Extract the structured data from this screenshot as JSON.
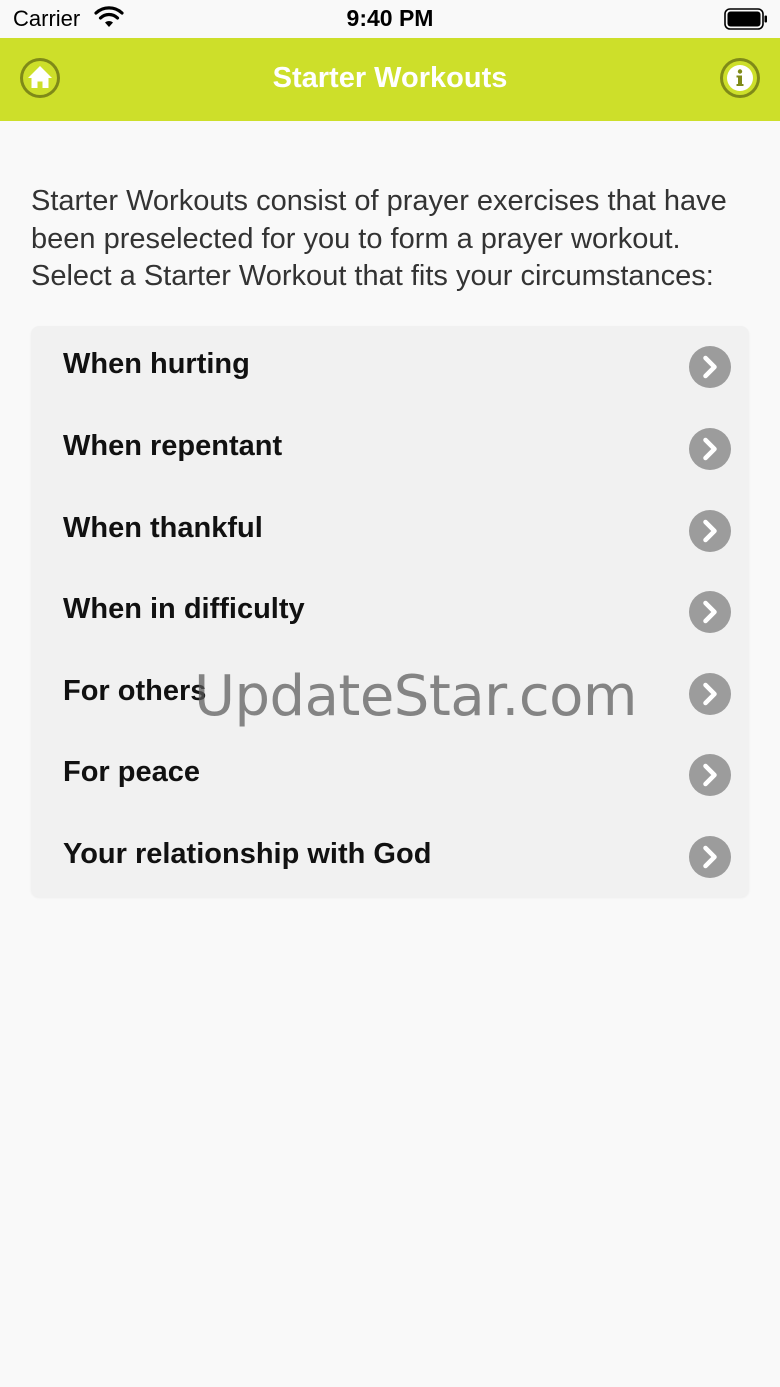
{
  "status_bar": {
    "carrier": "Carrier",
    "time": "9:40 PM"
  },
  "nav": {
    "title": "Starter Workouts",
    "bar_color": "#cddf2a",
    "left_icon": "home-icon",
    "right_icon": "info-icon"
  },
  "intro": "Starter Workouts consist of prayer exercises that have been preselected for you to form a prayer workout. Select a Starter Workout that fits your circumstances:",
  "workouts": [
    {
      "label": "When hurting"
    },
    {
      "label": "When repentant"
    },
    {
      "label": "When thankful"
    },
    {
      "label": "When in difficulty"
    },
    {
      "label": "For others"
    },
    {
      "label": "For peace"
    },
    {
      "label": "Your relationship with God"
    }
  ],
  "watermark": "UpdateStar.com"
}
